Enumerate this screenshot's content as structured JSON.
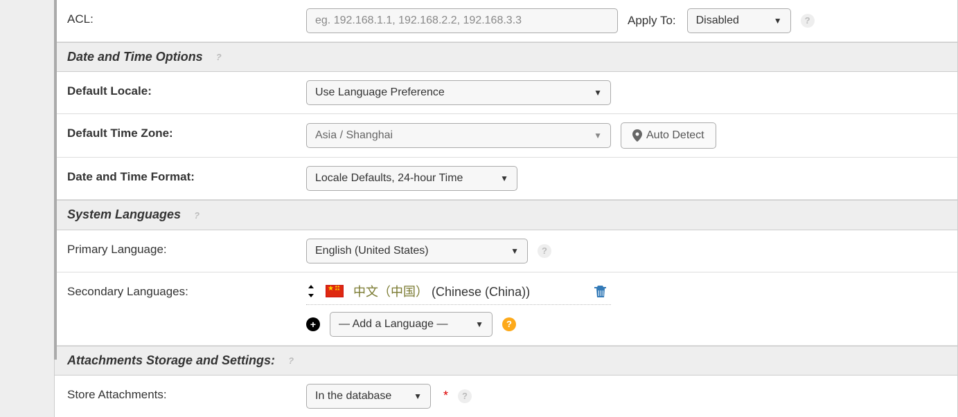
{
  "acl": {
    "label": "ACL:",
    "placeholder": "eg. 192.168.1.1, 192.168.2.2, 192.168.3.3",
    "value": "",
    "apply_to_label": "Apply To:",
    "apply_to_value": "Disabled"
  },
  "date_time_section": {
    "title": "Date and Time Options",
    "default_locale_label": "Default Locale:",
    "default_locale_value": "Use Language Preference",
    "default_tz_label": "Default Time Zone:",
    "default_tz_value": "Asia / Shanghai",
    "auto_detect_label": "Auto Detect",
    "format_label": "Date and Time Format:",
    "format_value": "Locale Defaults, 24-hour Time"
  },
  "system_lang_section": {
    "title": "System Languages",
    "primary_label": "Primary Language:",
    "primary_value": "English (United States)",
    "secondary_label": "Secondary Languages:",
    "secondary_items": [
      {
        "native": "中文（中国）",
        "english": "(Chinese (China))",
        "flag": "cn"
      }
    ],
    "add_language_label": "— Add a Language —"
  },
  "attachments_section": {
    "title": "Attachments Storage and Settings:",
    "store_label": "Store Attachments:",
    "store_value": "In the database"
  }
}
